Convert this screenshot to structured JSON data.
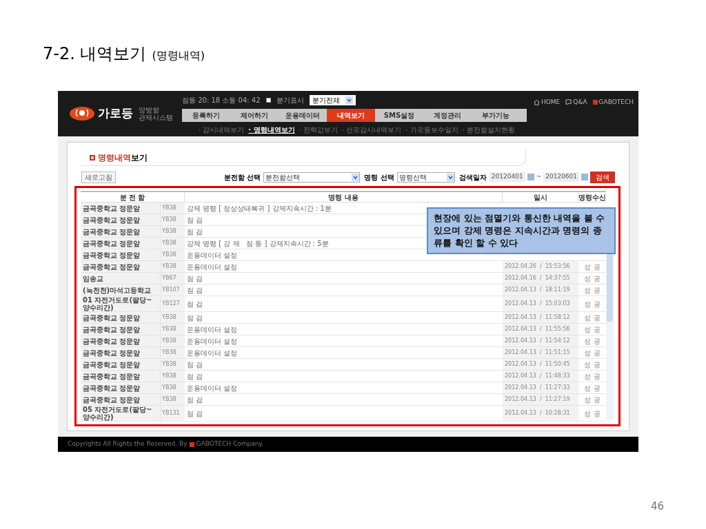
{
  "slide": {
    "title": "7-2. 내역보기",
    "subtitle": "(명령내역)",
    "page_number": "46"
  },
  "header": {
    "logo_text": "가로등",
    "logo_sub": [
      "양방향",
      "관제시스템"
    ],
    "lamp_info": "점등 20: 18 소등 04: 42",
    "branch_checkbox": {
      "label": "분기표시",
      "checked": false
    },
    "branch_select": "분기전체",
    "top_links": [
      {
        "kind": "home",
        "label": "HOME"
      },
      {
        "kind": "qa",
        "label": "Q&A"
      },
      {
        "kind": "brand",
        "label": "GABOTECH"
      }
    ],
    "menu": [
      {
        "label": "등록하기",
        "selected": false
      },
      {
        "label": "제어하기",
        "selected": false
      },
      {
        "label": "운용데이터",
        "selected": false
      },
      {
        "label": "내역보기",
        "selected": true
      },
      {
        "label": "SMS설정",
        "selected": false
      },
      {
        "label": "계정관리",
        "selected": false
      },
      {
        "label": "부가기능",
        "selected": false
      }
    ],
    "submenu": [
      {
        "label": "· 감시내역보기",
        "selected": false
      },
      {
        "label": "· 명령내역보기",
        "selected": true
      },
      {
        "label": "· 전력값보기",
        "selected": false
      },
      {
        "label": "· 선로감시내역보기",
        "selected": false
      },
      {
        "label": "· 가로등보수일지",
        "selected": false
      },
      {
        "label": "· 분전함설치현황",
        "selected": false
      }
    ]
  },
  "panel": {
    "title_red": "명령내역",
    "title_rest": "보기",
    "refresh_button": "새로고침",
    "filters": [
      {
        "label": "분전함 선택",
        "value": "분전함선택"
      },
      {
        "label": "명령 선택",
        "value": "명령선택"
      }
    ],
    "date_label": "검색일자",
    "date_from": "20120401",
    "date_sep": "~",
    "date_to": "20120601",
    "search_button": "검색"
  },
  "table": {
    "columns": [
      "분 전 함",
      "명령 내용",
      "일시",
      "명령수신"
    ],
    "rows": [
      {
        "cabinet": "금곡중학교 정문앞",
        "code": "YB38",
        "command": "강제 명령 [ 정상상태복귀 ] 강제지속시간 : 1분"
      },
      {
        "cabinet": "금곡중학교 정문앞",
        "code": "YB38",
        "command": "점 검"
      },
      {
        "cabinet": "금곡중학교 정문앞",
        "code": "YB38",
        "command": "점 검"
      },
      {
        "cabinet": "금곡중학교 정문앞",
        "code": "YB38",
        "command": "강제 명령 [ 강 제   점 등 ] 강제지속시간 : 5분"
      },
      {
        "cabinet": "금곡중학교 정문앞",
        "code": "YB38",
        "command": "운용데이터 설정"
      },
      {
        "cabinet": "금곡중학교 정문앞",
        "code": "YB38",
        "command": "운용데이터 설정",
        "datetime": "2012.04.26  /  15:53:56",
        "result": "성 공"
      },
      {
        "cabinet": "임송교",
        "code": "YB67",
        "command": "점 검",
        "datetime": "2012.04.16  /  14:37:55",
        "result": "성 공"
      },
      {
        "cabinet": "(녹천천)마석고등학교",
        "code": "YB107",
        "command": "점 검",
        "datetime": "2012.04.13  /  18:11:19",
        "result": "성 공"
      },
      {
        "cabinet": "01 자전거도로(팔당~양수리간)",
        "code": "YB127",
        "command": "점 검",
        "datetime": "2012.04.13  /  15:03:03",
        "result": "성 공"
      },
      {
        "cabinet": "금곡중학교 정문앞",
        "code": "YB38",
        "command": "점 검",
        "datetime": "2012.04.13  /  11:58:12",
        "result": "성 공"
      },
      {
        "cabinet": "금곡중학교 정문앞",
        "code": "YB38",
        "command": "운용데이터 설정",
        "datetime": "2012.04.13  /  11:55:56",
        "result": "성 공"
      },
      {
        "cabinet": "금곡중학교 정문앞",
        "code": "YB38",
        "command": "운용데이터 설정",
        "datetime": "2012.04.13  /  11:54:12",
        "result": "성 공"
      },
      {
        "cabinet": "금곡중학교 정문앞",
        "code": "YB38",
        "command": "운용데이터 설정",
        "datetime": "2012.04.13  /  11:51:15",
        "result": "성 공"
      },
      {
        "cabinet": "금곡중학교 정문앞",
        "code": "YB38",
        "command": "점 검",
        "datetime": "2012.04.13  /  11:50:45",
        "result": "성 공"
      },
      {
        "cabinet": "금곡중학교 정문앞",
        "code": "YB38",
        "command": "점 검",
        "datetime": "2012.04.13  /  11:48:33",
        "result": "성 공"
      },
      {
        "cabinet": "금곡중학교 정문앞",
        "code": "YB38",
        "command": "운용데이터 설정",
        "datetime": "2012.04.13  /  11:27:33",
        "result": "성 공"
      },
      {
        "cabinet": "금곡중학교 정문앞",
        "code": "YB38",
        "command": "점 검",
        "datetime": "2012.04.13  /  11:27:19",
        "result": "성 공"
      },
      {
        "cabinet": "05 자전거도로(팔당~양수리간)",
        "code": "YB131",
        "command": "점 검",
        "datetime": "2012.04.13  /  10:28:31",
        "result": "성 공"
      }
    ]
  },
  "callout": "현장에 있는 점멸기와 통신한 내역을 볼 수 있으며 강제 명령은 지속시간과 명령의 종류를 확인 할 수 있다",
  "footer": {
    "copyright": "Copyrights All Rights the Reserved. By",
    "brand": "GABOTECH",
    "suffix": "Company."
  }
}
